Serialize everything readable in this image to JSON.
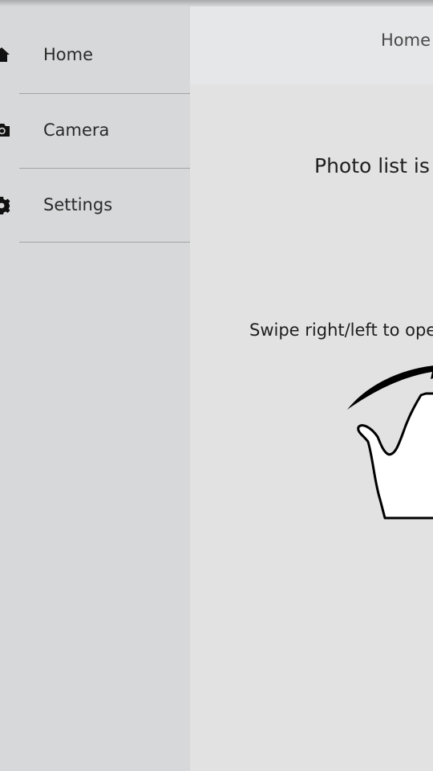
{
  "drawer": {
    "items": [
      {
        "label": "Home",
        "icon": "home-icon"
      },
      {
        "label": "Camera",
        "icon": "camera-icon"
      },
      {
        "label": "Settings",
        "icon": "gear-icon"
      }
    ]
  },
  "header": {
    "title": "Home"
  },
  "main": {
    "empty_message": "Photo list is",
    "hint": "Swipe right/left to oper"
  },
  "colors": {
    "drawer_bg": "#d7d8d9",
    "content_bg": "#e1e2e1",
    "header_bg": "#e6e7e8",
    "divider": "#a2a3a4"
  }
}
